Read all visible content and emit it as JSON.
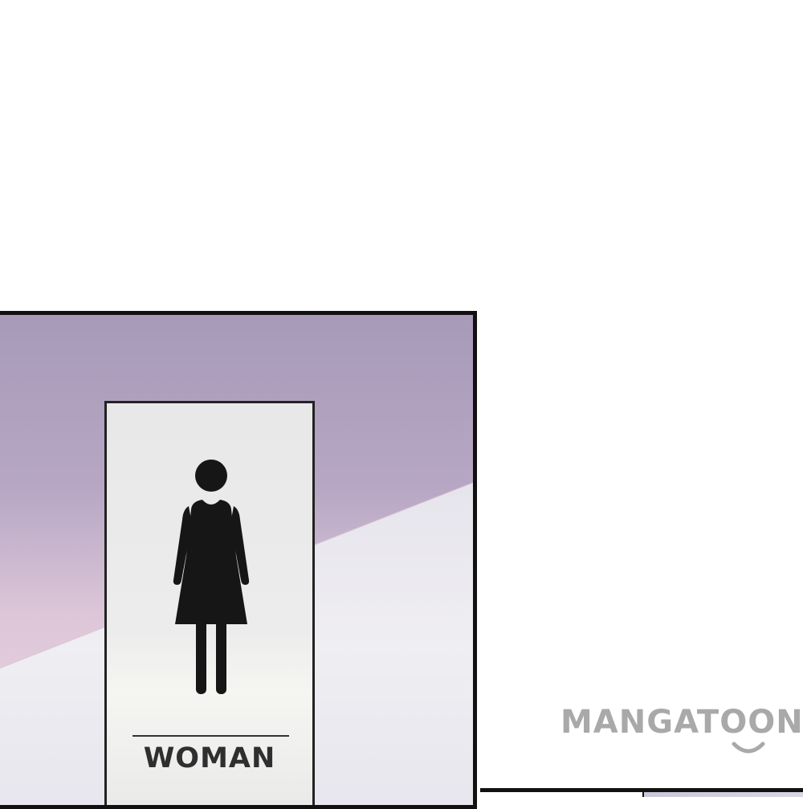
{
  "sign": {
    "label": "WOMAN",
    "icon": "woman-restroom-icon"
  },
  "watermark": {
    "text": "MANGATOON"
  },
  "colors": {
    "panel_top": "#a79ab8",
    "panel_pink": "#e8d2e0",
    "panel_bottom": "#eceaf0",
    "figure": "#161616",
    "sign_text": "#2f2f2f",
    "watermark": "#a9a9a9",
    "border": "#111111"
  }
}
